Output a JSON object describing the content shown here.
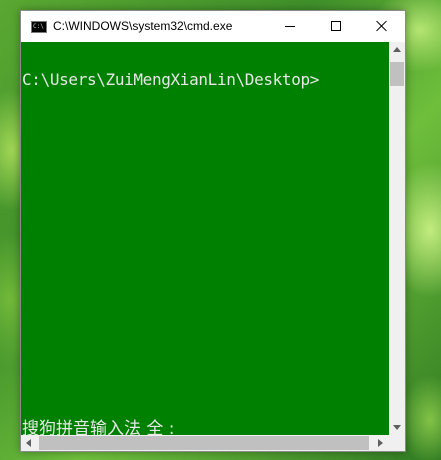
{
  "window": {
    "title": "C:\\WINDOWS\\system32\\cmd.exe",
    "icon_text": "C:\\"
  },
  "console": {
    "background_color": "#008000",
    "text_color": "#e8e8e8",
    "prompt": "C:\\Users\\ZuiMengXianLin\\Desktop>",
    "ime_status": "搜狗拼音输入法 全 :"
  },
  "icons": {
    "app": "cmd-app-icon",
    "minimize": "minimize-icon",
    "maximize": "maximize-icon",
    "close": "close-icon"
  }
}
